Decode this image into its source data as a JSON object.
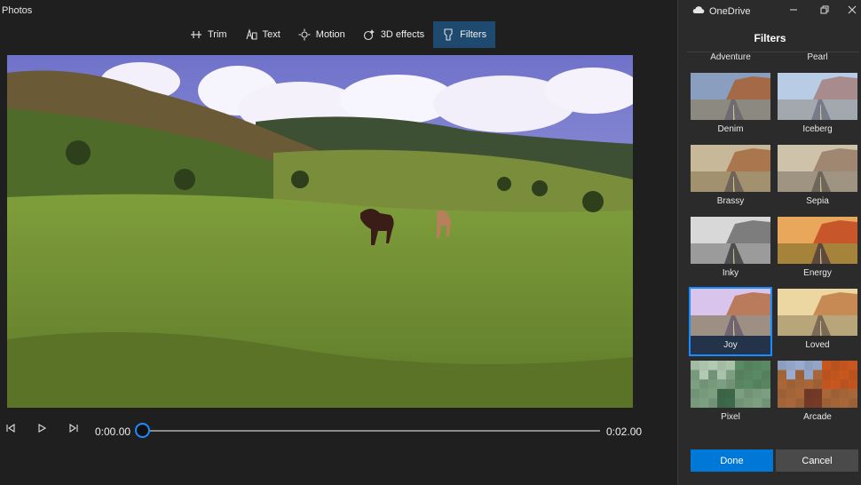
{
  "app": {
    "title": "Photos"
  },
  "toolbar": {
    "items": [
      {
        "label": "Trim",
        "icon": "trim-icon"
      },
      {
        "label": "Text",
        "icon": "text-icon"
      },
      {
        "label": "Motion",
        "icon": "motion-icon"
      },
      {
        "label": "3D effects",
        "icon": "3d-effects-icon"
      },
      {
        "label": "Filters",
        "icon": "filters-icon",
        "active": true
      }
    ]
  },
  "playback": {
    "current_time": "0:00.00",
    "end_time": "0:02.00",
    "progress": 0
  },
  "panel": {
    "account": "OneDrive",
    "heading": "Filters",
    "cut_labels": [
      "Adventure",
      "Pearl"
    ],
    "filters": [
      {
        "label": "Denim"
      },
      {
        "label": "Iceberg"
      },
      {
        "label": "Brassy"
      },
      {
        "label": "Sepia"
      },
      {
        "label": "Inky"
      },
      {
        "label": "Energy"
      },
      {
        "label": "Joy",
        "selected": true
      },
      {
        "label": "Loved"
      },
      {
        "label": "Pixel"
      },
      {
        "label": "Arcade"
      }
    ],
    "done_label": "Done",
    "cancel_label": "Cancel"
  },
  "colors": {
    "accent": "#0078d7",
    "active_tool": "#1d4a6e",
    "selected_outline": "#1a8cff"
  }
}
